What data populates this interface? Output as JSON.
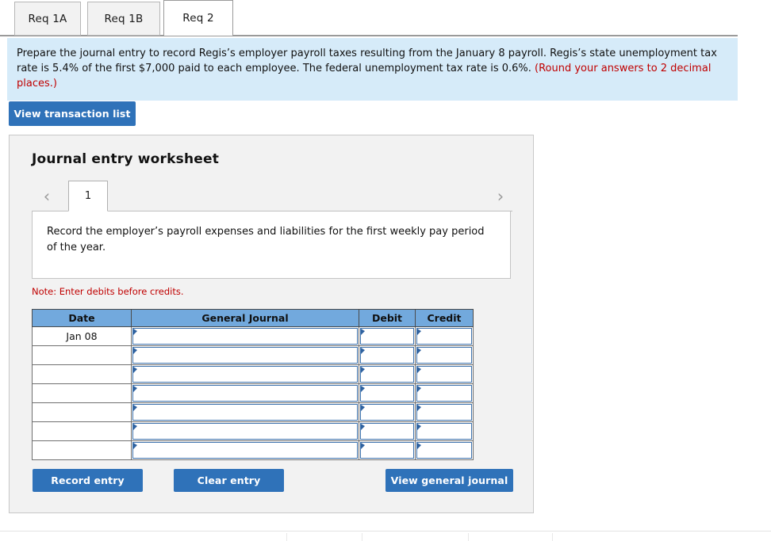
{
  "tabs": [
    {
      "label": "Req 1A",
      "active": false
    },
    {
      "label": "Req 1B",
      "active": false
    },
    {
      "label": "Req 2",
      "active": true
    }
  ],
  "instructions": {
    "body": "Prepare the journal entry to record Regis’s employer payroll taxes resulting from the January 8 payroll. Regis’s state unemployment tax rate is 5.4% of the first $7,000 paid to each employee. The federal unemployment tax rate is 0.6%. ",
    "hint": "(Round your answers to 2 decimal places.)"
  },
  "toolbar": {
    "view_transaction_list_label": "View transaction list"
  },
  "worksheet": {
    "title": "Journal entry worksheet",
    "prev_icon": "chevron-left-icon",
    "next_icon": "chevron-right-icon",
    "prev_glyph": "‹",
    "next_glyph": "›",
    "page_tab_label": "1",
    "description": "Record the employer’s payroll expenses and liabilities for the first weekly pay period of the year.",
    "note": "Note: Enter debits before credits.",
    "table": {
      "headers": [
        "Date",
        "General Journal",
        "Debit",
        "Credit"
      ],
      "rows": [
        {
          "date": "Jan 08",
          "general_journal": "",
          "debit": "",
          "credit": ""
        },
        {
          "date": "",
          "general_journal": "",
          "debit": "",
          "credit": ""
        },
        {
          "date": "",
          "general_journal": "",
          "debit": "",
          "credit": ""
        },
        {
          "date": "",
          "general_journal": "",
          "debit": "",
          "credit": ""
        },
        {
          "date": "",
          "general_journal": "",
          "debit": "",
          "credit": ""
        },
        {
          "date": "",
          "general_journal": "",
          "debit": "",
          "credit": ""
        },
        {
          "date": "",
          "general_journal": "",
          "debit": "",
          "credit": ""
        }
      ]
    },
    "buttons": {
      "record_entry": "Record entry",
      "clear_entry": "Clear entry",
      "view_general_journal": "View general journal"
    }
  },
  "colors": {
    "accent_blue": "#2f72b9",
    "table_header_blue": "#72a9dd",
    "instruction_panel": "#d6ebf9",
    "note_red": "#c00000",
    "panel_gray": "#f2f2f2"
  }
}
